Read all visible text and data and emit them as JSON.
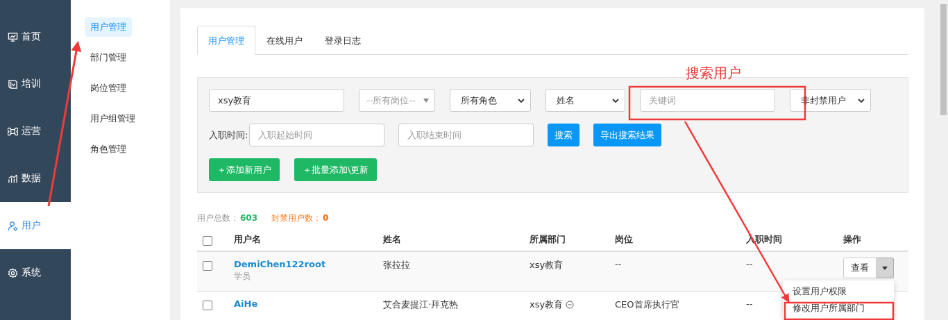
{
  "nav": [
    {
      "label": "首页",
      "selected": false
    },
    {
      "label": "培训",
      "selected": false
    },
    {
      "label": "运营",
      "selected": false
    },
    {
      "label": "数据",
      "selected": false
    },
    {
      "label": "用户",
      "selected": true
    },
    {
      "label": "系统",
      "selected": false
    }
  ],
  "submenu": [
    {
      "label": "用户管理",
      "selected": true
    },
    {
      "label": "部门管理",
      "selected": false
    },
    {
      "label": "岗位管理",
      "selected": false
    },
    {
      "label": "用户组管理",
      "selected": false
    },
    {
      "label": "角色管理",
      "selected": false
    }
  ],
  "tabs": [
    {
      "label": "用户管理",
      "selected": true
    },
    {
      "label": "在线用户",
      "selected": false
    },
    {
      "label": "登录日志",
      "selected": false
    }
  ],
  "filters": {
    "org_field": {
      "value": "xsy教育"
    },
    "selects": [
      {
        "placeholder": "--所有岗位--",
        "kind": "triangle"
      },
      {
        "value": "所有角色",
        "kind": "chevron"
      },
      {
        "value": "姓名",
        "kind": "chevron"
      }
    ],
    "keyword_field": {
      "placeholder": "关键词"
    },
    "status_select": {
      "value": "非封禁用户",
      "kind": "chevron"
    },
    "hire_label": "入职时间:",
    "start_field": {
      "placeholder": "入职起始时间"
    },
    "end_field": {
      "placeholder": "入职结束时间"
    },
    "search_buttons": [
      {
        "label": "搜索"
      },
      {
        "label": "导出搜索结果"
      }
    ],
    "add_buttons": [
      {
        "label": "＋添加新用户"
      },
      {
        "label": "＋批量添加\\更新"
      }
    ]
  },
  "stats": [
    {
      "label": "用户总数：",
      "value": "603",
      "kind": "total"
    },
    {
      "label": "封禁用户数：",
      "value": "0",
      "kind": "banned"
    }
  ],
  "table": {
    "header_checked": false,
    "columns": [
      "用户名",
      "姓名",
      "所属部门",
      "岗位",
      "入职时间",
      "操作"
    ],
    "rows": [
      {
        "checked": false,
        "username": "DemiChen122root",
        "role": "学员",
        "name": "张拉拉",
        "department": "xsy教育",
        "department_info": false,
        "position": "--",
        "hire_date": "--",
        "action": "查看",
        "menu_open": true
      },
      {
        "checked": false,
        "username": "AiHe",
        "name": "艾合麦提江·拜克热",
        "department": "xsy教育",
        "department_info": true,
        "position": "CEO首席执行官",
        "hire_date": "--"
      }
    ]
  },
  "action_menu": [
    {
      "label": "设置用户权限"
    },
    {
      "label": "修改用户所属部门"
    }
  ],
  "annotation": {
    "label": "搜索用户"
  }
}
